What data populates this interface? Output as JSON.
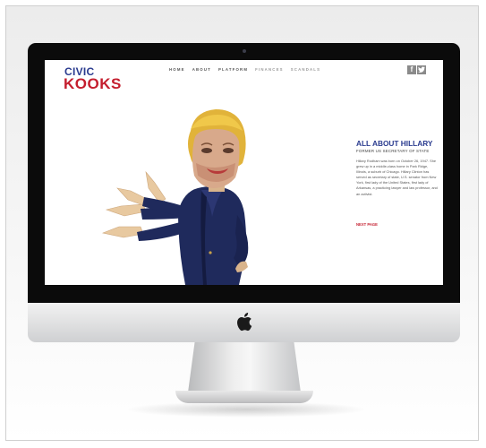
{
  "site": {
    "logo_line1": "CIVIC",
    "logo_line2": "KOOKS"
  },
  "nav": {
    "items": [
      "HOME",
      "ABOUT",
      "PLATFORM",
      "FINANCES",
      "SCANDALS"
    ]
  },
  "social": {
    "facebook_glyph": "f",
    "twitter_icon": "twitter-bird-icon"
  },
  "content": {
    "title": "ALL ABOUT HILLARY",
    "subtitle": "FORMER US SECRETARY OF STATE",
    "body": "Hillary Rodham was born on October 26, 1947. She grew up in a middle-class home in Park Ridge, Illinois, a suburb of Chicago. Hillary Clinton has served as secretary of state, U.S. senator from New York, first lady of the United States, first lady of Arkansas, a practicing lawyer and law professor, and an activist.",
    "next_link": "NEXT PAGE"
  },
  "colors": {
    "brand_blue": "#2a3b8f",
    "brand_red": "#c41e2e",
    "suit_navy": "#1f2a5c",
    "hair_blonde": "#e1b33a"
  },
  "device": {
    "brand_icon": "apple-logo-icon"
  }
}
